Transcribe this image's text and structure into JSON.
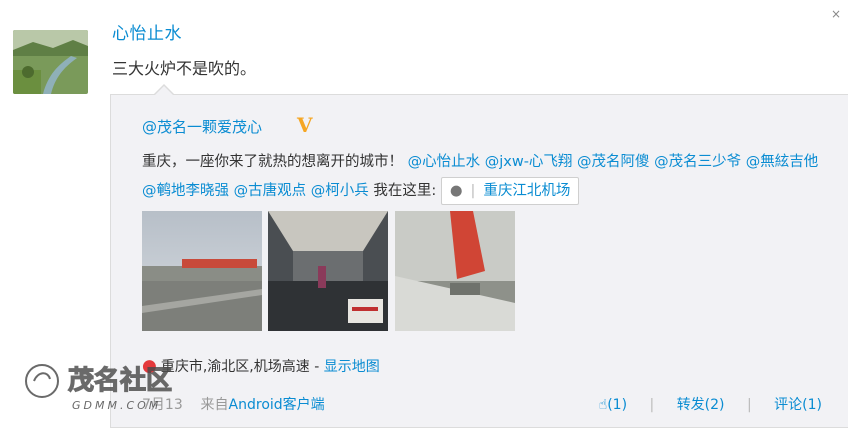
{
  "post": {
    "author": "心怡止水",
    "text": "三大火炉不是吹的。",
    "close_glyph": "×"
  },
  "repost": {
    "author": "@茂名一颗爱茂心",
    "badge": "V",
    "text_intro": "重庆，一座你来了就热的想离开的城市！",
    "mentions": [
      "@心怡止水",
      "@jxw-心飞翔",
      "@茂名阿傻",
      "@茂名三少爷",
      "@無絃吉他",
      "@鹌地李晓强",
      "@古唐观点",
      "@柯小兵"
    ],
    "location_prefix": "我在这里:",
    "place_name": "重庆江北机场",
    "images": [
      "airport-tarmac-photo",
      "airplane-cabin-photo",
      "airplane-wing-photo"
    ],
    "geo_address": "重庆市,渝北区,机场高速 - ",
    "show_map_label": "显示地图",
    "time": "7月13",
    "source_prefix": "来自",
    "source_client": "Android客户端",
    "like_label": "(1)",
    "repost_label": "转发(2)",
    "comment_label": "评论(1)"
  },
  "watermark": {
    "text": "茂名社区",
    "subtext": "GDMM.COM"
  },
  "colors": {
    "link": "#0a8cd2",
    "box_bg": "#f2f2f5",
    "badge": "#f5a623",
    "map_pin": "#e4393c"
  }
}
